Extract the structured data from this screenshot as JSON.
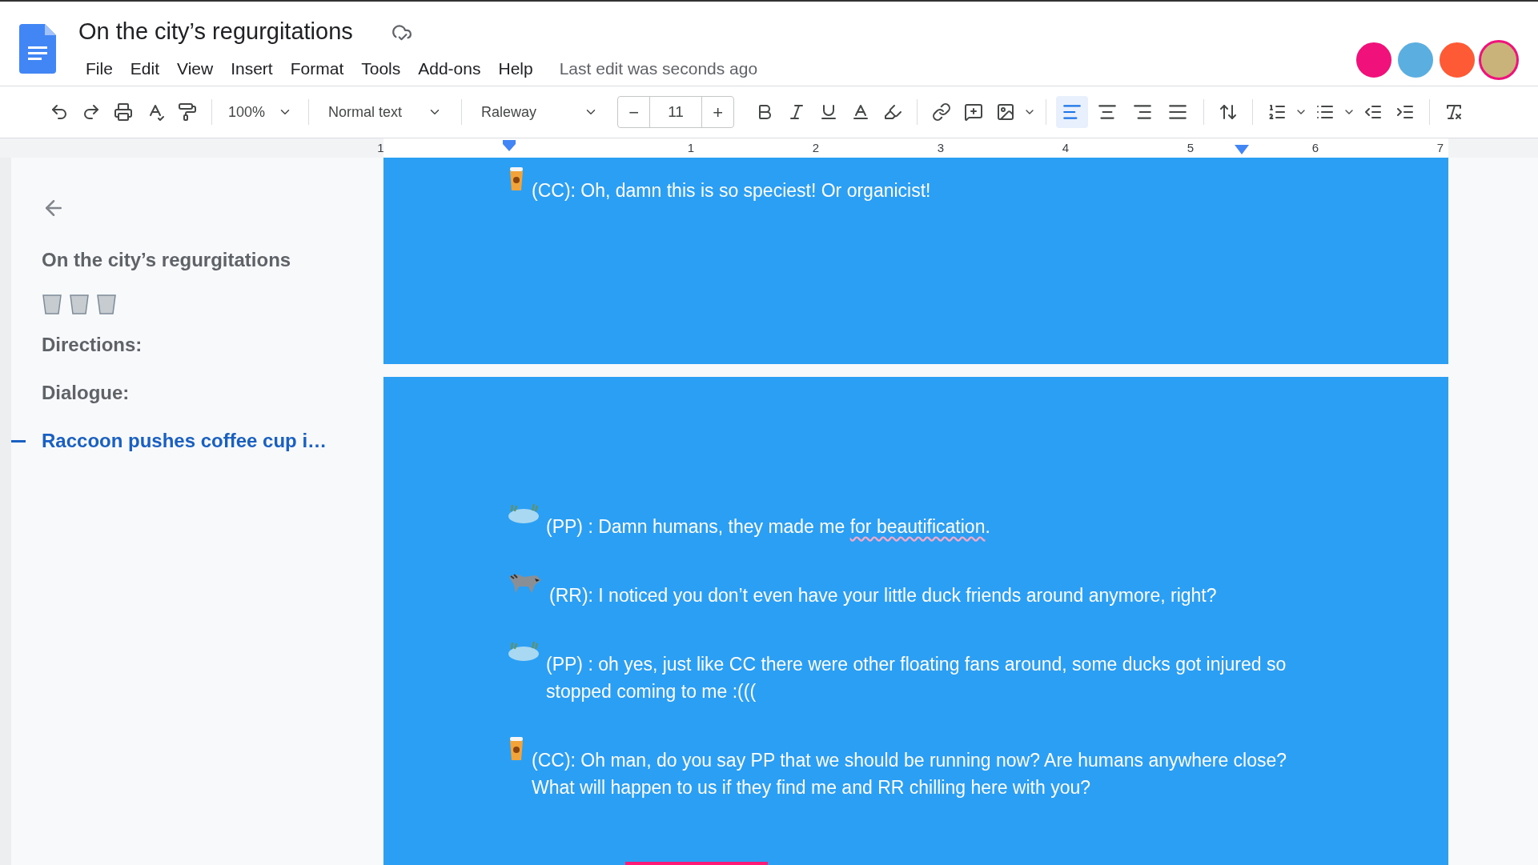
{
  "document": {
    "title": "On the city’s regurgitations",
    "status": "Last edit was seconds ago"
  },
  "menu": [
    "File",
    "Edit",
    "View",
    "Insert",
    "Format",
    "Tools",
    "Add-ons",
    "Help"
  ],
  "avatars": [
    {
      "kind": "logo",
      "color": "#f0127a"
    },
    {
      "kind": "logo",
      "color": "#5aafe0"
    },
    {
      "kind": "logo",
      "color": "#ff5a36"
    },
    {
      "kind": "photo",
      "color": "#f0127a"
    }
  ],
  "toolbar": {
    "zoom": "100%",
    "style": "Normal text",
    "font": "Raleway",
    "size": "11",
    "minus": "−",
    "plus": "+",
    "align": [
      {
        "kind": "left",
        "selected": true
      },
      {
        "kind": "center",
        "selected": false
      },
      {
        "kind": "right",
        "selected": false
      },
      {
        "kind": "justify",
        "selected": false
      }
    ]
  },
  "ruler": [
    "1",
    "1",
    "2",
    "3",
    "4",
    "5",
    "6",
    "7"
  ],
  "outline": [
    {
      "text": "On the city’s regurgitations",
      "selected": false
    },
    {
      "text": "Directions:",
      "selected": false
    },
    {
      "text": "Dialogue:",
      "selected": false
    },
    {
      "text": "Raccoon pushes coffee cup i…",
      "selected": true
    }
  ],
  "page1": [
    {
      "kind": "cup",
      "parts": [
        {
          "text": "(CC): Oh, damn this is so speciest! Or organicist!",
          "flagged": false
        }
      ]
    }
  ],
  "page2": [
    {
      "kind": "pond",
      "parts": [
        {
          "text": "(PP) : Damn humans, they made me ",
          "flagged": false
        },
        {
          "text": "for beautification",
          "flagged": true
        },
        {
          "text": ".",
          "flagged": false
        }
      ]
    },
    {
      "kind": "raccoon",
      "parts": [
        {
          "text": "(RR): I noticed you don’t even have your little duck friends around anymore, right?",
          "flagged": false
        }
      ]
    },
    {
      "kind": "pond",
      "parts": [
        {
          "text": "(PP) : oh yes, just like CC there were other floating fans around, some ducks got injured so stopped coming to me :(((",
          "flagged": false
        }
      ]
    },
    {
      "kind": "cup",
      "parts": [
        {
          "text": "(CC): Oh man, do you say PP that we should be running now? Are humans anywhere close? What will happen to us if they find me and RR chilling here with you?",
          "flagged": false
        }
      ]
    }
  ]
}
